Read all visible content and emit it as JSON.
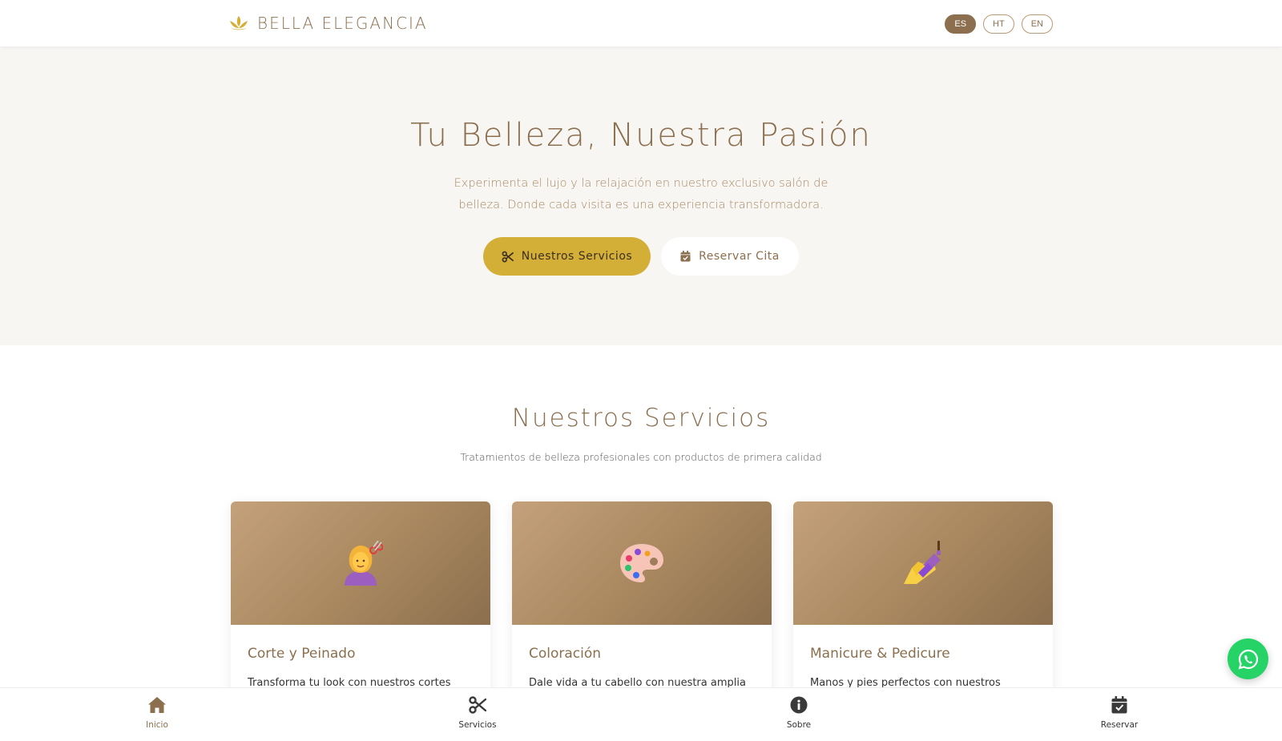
{
  "header": {
    "brand": "BELLA ELEGANCIA",
    "languages": [
      {
        "code": "ES",
        "active": true
      },
      {
        "code": "HT",
        "active": false
      },
      {
        "code": "EN",
        "active": false
      }
    ]
  },
  "hero": {
    "title": "Tu Belleza, Nuestra Pasión",
    "subtitle": "Experimenta el lujo y la relajación en nuestro exclusivo salón de belleza. Donde cada visita es una experiencia transformadora.",
    "primary_button": "Nuestros Servicios",
    "secondary_button": "Reservar Cita"
  },
  "services": {
    "title": "Nuestros Servicios",
    "subtitle": "Tratamientos de belleza profesionales con productos de primera calidad",
    "cards": [
      {
        "icon": "haircut-emoji",
        "emoji": "💇‍♀️",
        "title": "Corte y Peinado",
        "description": "Transforma tu look con nuestros cortes"
      },
      {
        "icon": "palette-emoji",
        "emoji": "🎨",
        "title": "Coloración",
        "description": "Dale vida a tu cabello con nuestra amplia"
      },
      {
        "icon": "nail-polish-emoji",
        "emoji": "💅",
        "title": "Manicure & Pedicure",
        "description": "Manos y pies perfectos con nuestros"
      }
    ]
  },
  "bottom_nav": {
    "items": [
      {
        "label": "Inicio",
        "icon": "home-icon",
        "active": true
      },
      {
        "label": "Servicios",
        "icon": "scissors-icon",
        "active": false
      },
      {
        "label": "Sobre",
        "icon": "info-icon",
        "active": false
      },
      {
        "label": "Reservar",
        "icon": "calendar-check-icon",
        "active": false
      }
    ]
  },
  "colors": {
    "brand_brown": "#8b6f4e",
    "gold": "#d4af37",
    "hero_bg": "#f8f6f3",
    "whatsapp_green": "#25d366"
  }
}
